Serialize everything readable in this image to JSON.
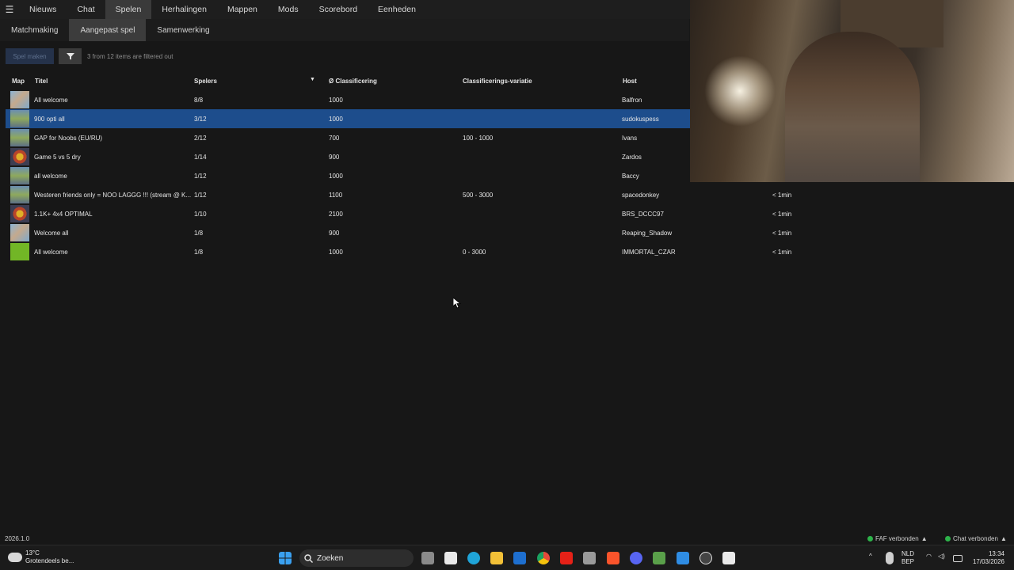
{
  "nav": {
    "main_tabs": [
      "Nieuws",
      "Chat",
      "Spelen",
      "Herhalingen",
      "Mappen",
      "Mods",
      "Scorebord",
      "Eenheden"
    ],
    "active_main_tab": "Spelen",
    "sub_tabs": [
      "Matchmaking",
      "Aangepast spel",
      "Samenwerking"
    ],
    "active_sub_tab": "Aangepast spel"
  },
  "toolbar": {
    "new_game_label": "Spel maken",
    "filter_icon": "filter-icon",
    "filter_status": "3 from 12 items are filtered out"
  },
  "table": {
    "headers": {
      "map": "Map",
      "title": "Titel",
      "players": "Spelers",
      "rating": "Ø Classificering",
      "rating_range": "Classificerings-variatie",
      "host": "Host"
    },
    "sorted_column": "players",
    "rows": [
      {
        "title": "All welcome",
        "players": "8/8",
        "rating": "1000",
        "range": "",
        "host": "Balfron",
        "age": "",
        "thumb": "t0",
        "selected": false
      },
      {
        "title": "900 opti all",
        "players": "3/12",
        "rating": "1000",
        "range": "",
        "host": "sudokuspess",
        "age": "",
        "thumb": "t1",
        "selected": true
      },
      {
        "title": "GAP for Noobs (EU/RU)",
        "players": "2/12",
        "rating": "700",
        "range": "100 - 1000",
        "host": "Ivans",
        "age": "",
        "thumb": "t1",
        "selected": false
      },
      {
        "title": "Game 5 vs 5 dry",
        "players": "1/14",
        "rating": "900",
        "range": "",
        "host": "Zardos",
        "age": "",
        "thumb": "t2",
        "selected": false
      },
      {
        "title": "all welcome",
        "players": "1/12",
        "rating": "1000",
        "range": "",
        "host": "Baccy",
        "age": "",
        "thumb": "t1",
        "selected": false
      },
      {
        "title": "Westeren friends only = NOO LAGGG !!! (stream @ K...",
        "players": "1/12",
        "rating": "1100",
        "range": "500 - 3000",
        "host": "spacedonkey",
        "age": "< 1min",
        "thumb": "t1",
        "selected": false
      },
      {
        "title": "1.1K+ 4x4 OPTIMAL",
        "players": "1/10",
        "rating": "2100",
        "range": "",
        "host": "BRS_DCCC97",
        "age": "< 1min",
        "thumb": "t2",
        "selected": false
      },
      {
        "title": "Welcome all",
        "players": "1/8",
        "rating": "900",
        "range": "",
        "host": "Reaping_Shadow",
        "age": "< 1min",
        "thumb": "t0",
        "selected": false
      },
      {
        "title": "All welcome",
        "players": "1/8",
        "rating": "1000",
        "range": "0 - 3000",
        "host": "IMMORTAL_CZAR",
        "age": "< 1min",
        "thumb": "t3",
        "selected": false
      }
    ]
  },
  "status": {
    "version": "2026.1.0",
    "faf": "FAF verbonden",
    "chat": "Chat verbonden"
  },
  "taskbar": {
    "temperature": "13°C",
    "weather": "Grotendeels be...",
    "search_placeholder": "Zoeken",
    "lang_top": "NLD",
    "lang_bottom": "BEP",
    "time": "13:34",
    "date": "17/03/2026"
  },
  "colors": {
    "selection": "#1d4d8c",
    "connected": "#2db34a",
    "background": "#171717"
  }
}
